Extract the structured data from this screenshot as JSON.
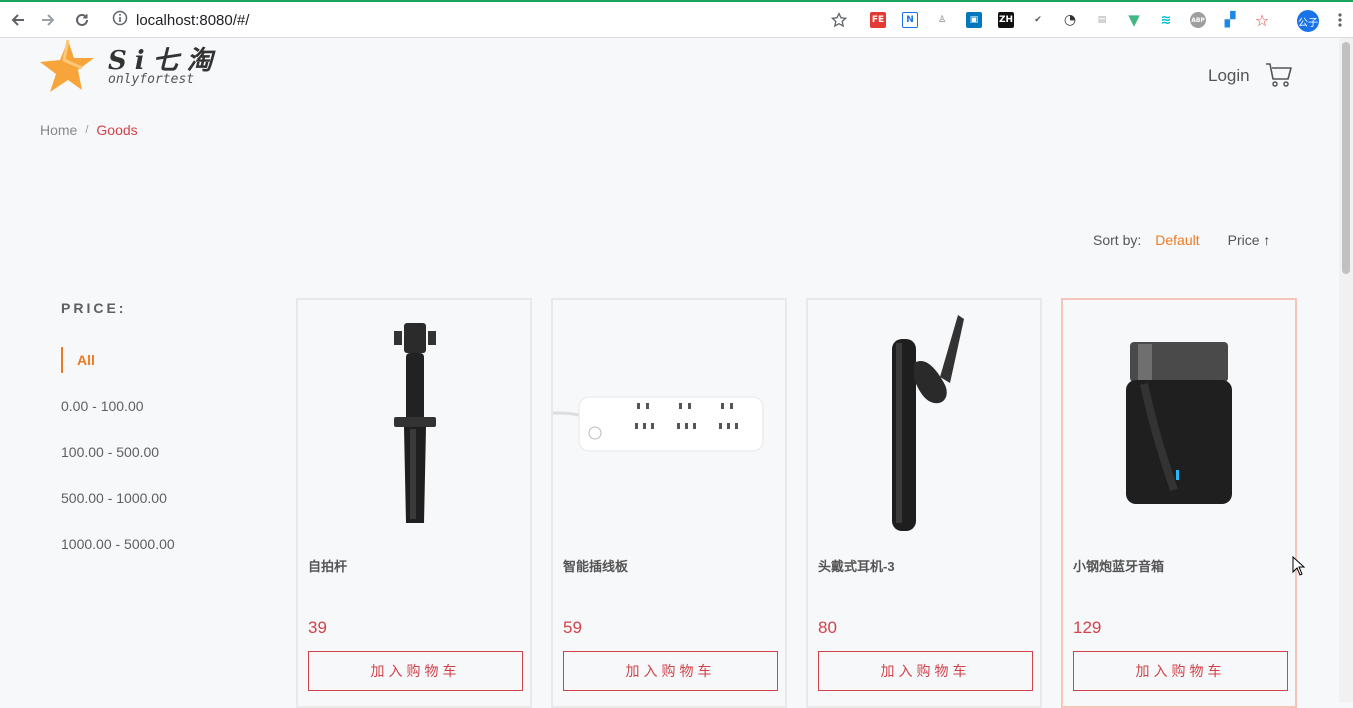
{
  "browser": {
    "url": "localhost:8080/#/",
    "avatar_label": "公子",
    "extensions": [
      "FE",
      "N",
      "ZH",
      "ABP"
    ]
  },
  "header": {
    "logo_text": "Si七淘",
    "logo_sub": "onlyfortest",
    "login_label": "Login",
    "cart_icon": "cart-icon"
  },
  "breadcrumb": {
    "home": "Home",
    "separator": "/",
    "current": "Goods"
  },
  "sort": {
    "label": "Sort by:",
    "default": "Default",
    "price": "Price",
    "price_arrow": "↑"
  },
  "filter": {
    "title": "PRICE:",
    "items": [
      "All",
      "0.00 - 100.00",
      "100.00 - 500.00",
      "500.00 - 1000.00",
      "1000.00 - 5000.00"
    ]
  },
  "goods": [
    {
      "name": "自拍杆",
      "price": "39",
      "button": "加入购物车"
    },
    {
      "name": "智能插线板",
      "price": "59",
      "button": "加入购物车"
    },
    {
      "name": "头戴式耳机-3",
      "price": "80",
      "button": "加入购物车"
    },
    {
      "name": "小钢炮蓝牙音箱",
      "price": "129",
      "button": "加入购物车"
    }
  ],
  "colors": {
    "accent": "#ee7a23",
    "price": "#d1434b",
    "chrome_top": "#1aa260"
  }
}
